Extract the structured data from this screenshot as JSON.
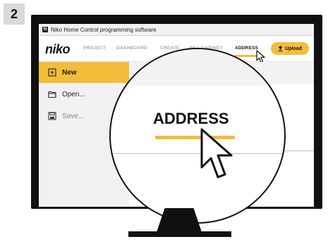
{
  "step_number": "2",
  "window": {
    "title": "Niko Home Control programming software"
  },
  "brand": {
    "logo": "niko",
    "accent_color": "#f2bd3b"
  },
  "nav": {
    "items": [
      {
        "label": "PROJECT",
        "active": false
      },
      {
        "label": "DASHBOARD",
        "active": false
      },
      {
        "label": "CREATE",
        "active": false
      },
      {
        "label": "FILL CABINET",
        "active": false
      },
      {
        "label": "ADDRESS",
        "active": true
      }
    ],
    "upload_label": "Upload"
  },
  "sidebar": {
    "items": [
      {
        "label": "New",
        "icon": "new-file-icon",
        "active": true
      },
      {
        "label": "Open...",
        "icon": "folder-icon",
        "active": false
      },
      {
        "label": "Save...",
        "icon": "save-icon",
        "active": false
      }
    ]
  },
  "magnifier": {
    "label": "ADDRESS",
    "background_fragment": "T"
  }
}
